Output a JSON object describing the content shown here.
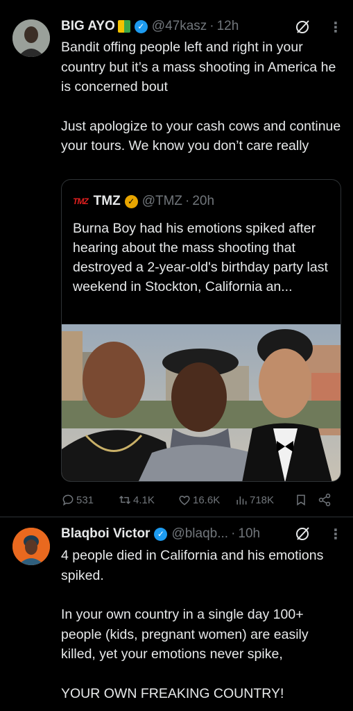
{
  "tweets": [
    {
      "display_name": "BIG AYO",
      "handle": "@47kasz",
      "time": "12h",
      "text": [
        "Bandit offing people left and right in your country but it’s a mass shooting in America  he is concerned bout",
        "Just apologize to your cash cows and continue your tours. We know you don’t care really"
      ],
      "quote": {
        "logo_text": "TMZ",
        "display_name": "TMZ",
        "handle": "@TMZ",
        "time": "20h",
        "text": "Burna Boy had his emotions spiked after hearing about the mass shooting that destroyed a 2-year-old's birthday party last weekend in Stockton, California an..."
      },
      "actions": {
        "replies": "531",
        "reposts": "4.1K",
        "likes": "16.6K",
        "views": "718K"
      }
    },
    {
      "display_name": "Blaqboi Victor",
      "handle": "@blaqb...",
      "time": "10h",
      "text": [
        "4 people died in California and his emotions spiked.",
        "In your own country in a single day 100+ people (kids, pregnant women) are easily killed, yet your emotions never spike,",
        "YOUR OWN FREAKING COUNTRY!"
      ]
    }
  ],
  "separator": "·",
  "more_glyph": "⋮",
  "colors": {
    "background": "#000000",
    "text": "#e7e9ea",
    "muted": "#71767b",
    "verified_blue": "#1d9bf0",
    "verified_gold": "#e8a500",
    "border": "#2f3336"
  },
  "icons": [
    "avatar",
    "verified-badge-icon",
    "grok-icon",
    "more-icon",
    "reply-icon",
    "retweet-icon",
    "like-icon",
    "views-icon",
    "bookmark-icon",
    "share-icon"
  ]
}
